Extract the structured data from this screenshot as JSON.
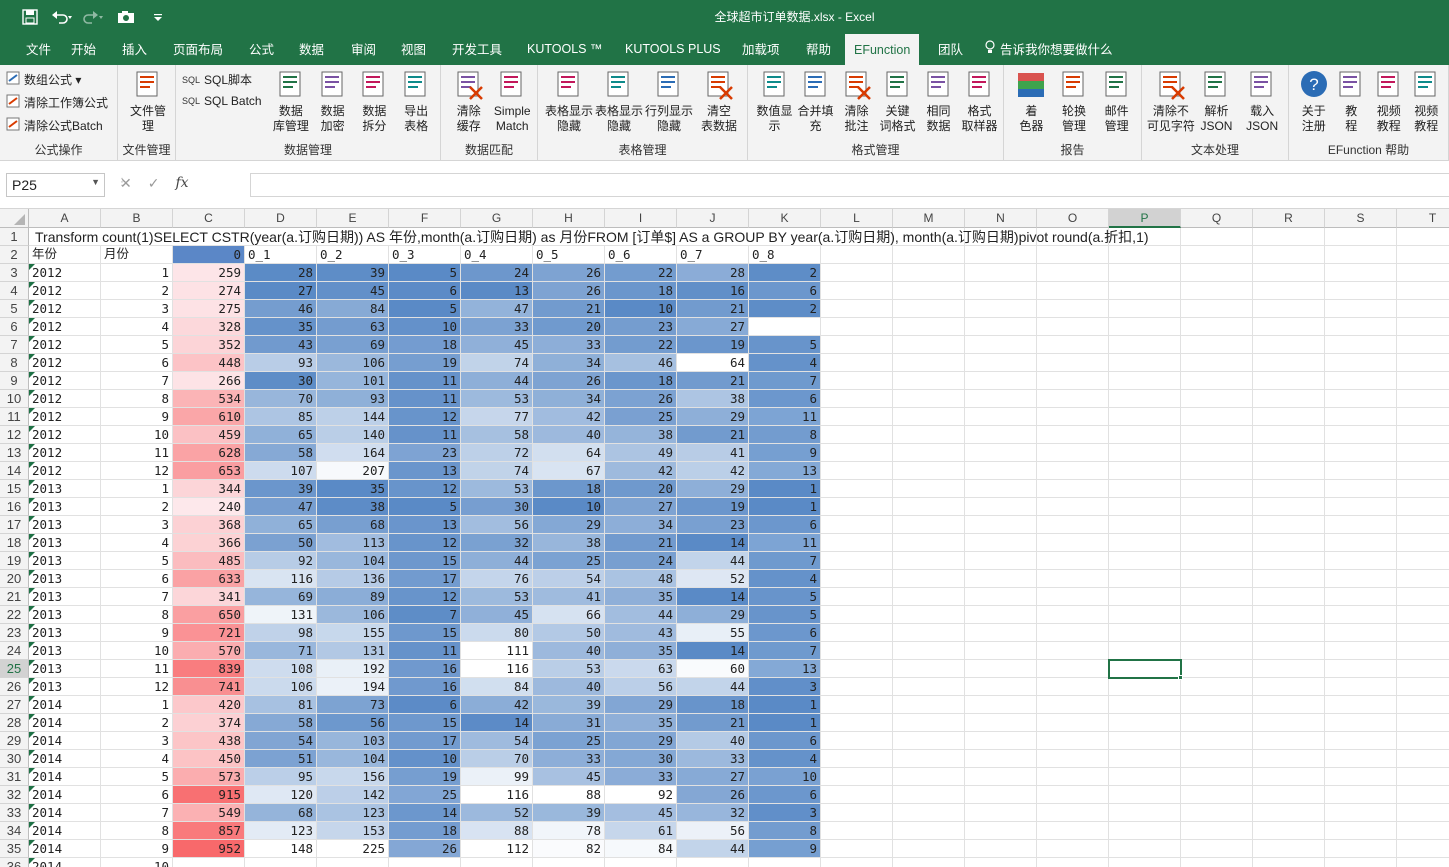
{
  "window": {
    "title": "全球超市订单数据.xlsx  -  Excel"
  },
  "qat": {
    "items": [
      "save-icon",
      "undo-icon",
      "redo-icon",
      "camera-icon",
      "customize-icon"
    ]
  },
  "tabs": [
    "文件",
    "开始",
    "插入",
    "页面布局",
    "公式",
    "数据",
    "审阅",
    "视图",
    "开发工具",
    "KUTOOLS ™",
    "KUTOOLS PLUS",
    "加载项",
    "帮助",
    "EFunction",
    "团队",
    "告诉我你想要做什么"
  ],
  "active_tab": "EFunction",
  "ribbon": {
    "groups": [
      {
        "label": "公式操作",
        "small": [
          "数组公式",
          "清除工作簿公式",
          "清除公式Batch"
        ]
      },
      {
        "label": "文件管理",
        "buttons": [
          "文件管\n理"
        ]
      },
      {
        "label": "数据管理",
        "small": [
          "SQL脚本",
          "SQL Batch"
        ],
        "buttons": [
          "数据\n库管理",
          "数据\n加密",
          "数据\n拆分",
          "导出\n表格"
        ]
      },
      {
        "label": "数据匹配",
        "buttons": [
          "清除\n缓存",
          "Simple\nMatch"
        ]
      },
      {
        "label": "表格管理",
        "buttons": [
          "表格显示\n隐藏",
          "表格显示\n隐藏",
          "行列显示\n隐藏",
          "清空\n表数据"
        ]
      },
      {
        "label": "格式管理",
        "buttons": [
          "数值显\n示",
          "合并填\n充",
          "清除\n批注",
          "关键\n词格式",
          "相同\n数据",
          "格式\n取样器"
        ]
      },
      {
        "label": "报告",
        "buttons": [
          "着\n色器",
          "轮换\n管理",
          "邮件\n管理"
        ]
      },
      {
        "label": "文本处理",
        "buttons": [
          "清除不\n可见字符",
          "解析\nJSON",
          "载入\nJSON"
        ]
      },
      {
        "label": "EFunction 帮助",
        "buttons": [
          "关于\n注册",
          "教\n程",
          "视频\n教程",
          "视频\n教程"
        ]
      }
    ],
    "sql_prefix": "SQL"
  },
  "formula_bar": {
    "name_box": "P25",
    "formula": "",
    "fx": "fx",
    "cancel": "✕",
    "confirm": "✓"
  },
  "sheet": {
    "columns": [
      "A",
      "B",
      "C",
      "D",
      "E",
      "F",
      "G",
      "H",
      "I",
      "J",
      "K",
      "L",
      "M",
      "N",
      "O",
      "P",
      "Q",
      "R",
      "S",
      "T"
    ],
    "selected_cell": "P25",
    "row1_text": "Transform count(1)SELECT  CSTR(year(a.订购日期)) AS 年份,month(a.订购日期) as 月份FROM  [订单$] AS a GROUP BY  year(a.订购日期),  month(a.订购日期)pivot   round(a.折扣,1)",
    "headers": [
      "年份",
      "月份",
      "0",
      "0_1",
      "0_2",
      "0_3",
      "0_4",
      "0_5",
      "0_6",
      "0_7",
      "0_8"
    ],
    "rows": [
      [
        "2012",
        "1",
        "259",
        "28",
        "39",
        "5",
        "24",
        "26",
        "22",
        "28",
        "2"
      ],
      [
        "2012",
        "2",
        "274",
        "27",
        "45",
        "6",
        "13",
        "26",
        "18",
        "16",
        "6"
      ],
      [
        "2012",
        "3",
        "275",
        "46",
        "84",
        "5",
        "47",
        "21",
        "10",
        "21",
        "2"
      ],
      [
        "2012",
        "4",
        "328",
        "35",
        "63",
        "10",
        "33",
        "20",
        "23",
        "27",
        ""
      ],
      [
        "2012",
        "5",
        "352",
        "43",
        "69",
        "18",
        "45",
        "33",
        "22",
        "19",
        "5"
      ],
      [
        "2012",
        "6",
        "448",
        "93",
        "106",
        "19",
        "74",
        "34",
        "46",
        "64",
        "4"
      ],
      [
        "2012",
        "7",
        "266",
        "30",
        "101",
        "11",
        "44",
        "26",
        "18",
        "21",
        "7"
      ],
      [
        "2012",
        "8",
        "534",
        "70",
        "93",
        "11",
        "53",
        "34",
        "26",
        "38",
        "6"
      ],
      [
        "2012",
        "9",
        "610",
        "85",
        "144",
        "12",
        "77",
        "42",
        "25",
        "29",
        "11"
      ],
      [
        "2012",
        "10",
        "459",
        "65",
        "140",
        "11",
        "58",
        "40",
        "38",
        "21",
        "8"
      ],
      [
        "2012",
        "11",
        "628",
        "58",
        "164",
        "23",
        "72",
        "64",
        "49",
        "41",
        "9"
      ],
      [
        "2012",
        "12",
        "653",
        "107",
        "207",
        "13",
        "74",
        "67",
        "42",
        "42",
        "13"
      ],
      [
        "2013",
        "1",
        "344",
        "39",
        "35",
        "12",
        "53",
        "18",
        "20",
        "29",
        "1"
      ],
      [
        "2013",
        "2",
        "240",
        "47",
        "38",
        "5",
        "30",
        "10",
        "27",
        "19",
        "1"
      ],
      [
        "2013",
        "3",
        "368",
        "65",
        "68",
        "13",
        "56",
        "29",
        "34",
        "23",
        "6"
      ],
      [
        "2013",
        "4",
        "366",
        "50",
        "113",
        "12",
        "32",
        "38",
        "21",
        "14",
        "11"
      ],
      [
        "2013",
        "5",
        "485",
        "92",
        "104",
        "15",
        "44",
        "25",
        "24",
        "44",
        "7"
      ],
      [
        "2013",
        "6",
        "633",
        "116",
        "136",
        "17",
        "76",
        "54",
        "48",
        "52",
        "4"
      ],
      [
        "2013",
        "7",
        "341",
        "69",
        "89",
        "12",
        "53",
        "41",
        "35",
        "14",
        "5"
      ],
      [
        "2013",
        "8",
        "650",
        "131",
        "106",
        "7",
        "45",
        "66",
        "44",
        "29",
        "5"
      ],
      [
        "2013",
        "9",
        "721",
        "98",
        "155",
        "15",
        "80",
        "50",
        "43",
        "55",
        "6"
      ],
      [
        "2013",
        "10",
        "570",
        "71",
        "131",
        "11",
        "111",
        "40",
        "35",
        "14",
        "7"
      ],
      [
        "2013",
        "11",
        "839",
        "108",
        "192",
        "16",
        "116",
        "53",
        "63",
        "60",
        "13"
      ],
      [
        "2013",
        "12",
        "741",
        "106",
        "194",
        "16",
        "84",
        "40",
        "56",
        "44",
        "3"
      ],
      [
        "2014",
        "1",
        "420",
        "81",
        "73",
        "6",
        "42",
        "39",
        "29",
        "18",
        "1"
      ],
      [
        "2014",
        "2",
        "374",
        "58",
        "56",
        "15",
        "14",
        "31",
        "35",
        "21",
        "1"
      ],
      [
        "2014",
        "3",
        "438",
        "54",
        "103",
        "17",
        "54",
        "25",
        "29",
        "40",
        "6"
      ],
      [
        "2014",
        "4",
        "450",
        "51",
        "104",
        "10",
        "70",
        "33",
        "30",
        "33",
        "4"
      ],
      [
        "2014",
        "5",
        "573",
        "95",
        "156",
        "19",
        "99",
        "45",
        "33",
        "27",
        "10"
      ],
      [
        "2014",
        "6",
        "915",
        "120",
        "142",
        "25",
        "116",
        "88",
        "92",
        "26",
        "6"
      ],
      [
        "2014",
        "7",
        "549",
        "68",
        "123",
        "14",
        "52",
        "39",
        "45",
        "32",
        "3"
      ],
      [
        "2014",
        "8",
        "857",
        "123",
        "153",
        "18",
        "88",
        "78",
        "61",
        "56",
        "8"
      ],
      [
        "2014",
        "9",
        "952",
        "148",
        "225",
        "26",
        "112",
        "82",
        "84",
        "44",
        "9"
      ],
      [
        "2014",
        "10",
        "",
        "",
        "",
        "",
        "",
        "",
        "",
        "",
        ""
      ]
    ]
  }
}
